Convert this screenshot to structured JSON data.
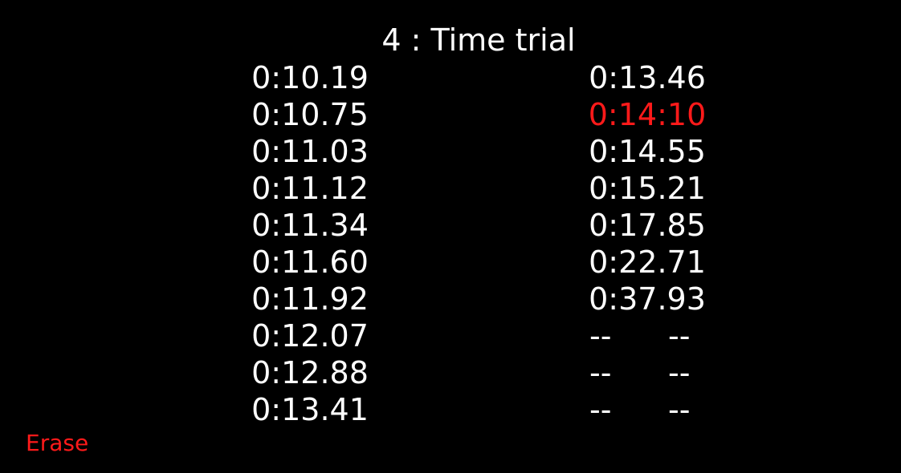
{
  "title": "4 : Time trial",
  "left_times": [
    "0:10.19",
    "0:10.75",
    "0:11.03",
    "0:11.12",
    "0:11.34",
    "0:11.60",
    "0:11.92",
    "0:12.07",
    "0:12.88",
    "0:13.41"
  ],
  "right_times": [
    "0:13.46",
    "0:14:10",
    "0:14.55",
    "0:15.21",
    "0:17.85",
    "0:22.71",
    "0:37.93"
  ],
  "highlighted_right_index": 1,
  "empty_slot": {
    "minutes": "--",
    "seconds": "--"
  },
  "empty_slot_count": 3,
  "erase_label": "Erase",
  "colors": {
    "background": "#000000",
    "text": "#ffffff",
    "highlight": "#ff1a1a"
  }
}
